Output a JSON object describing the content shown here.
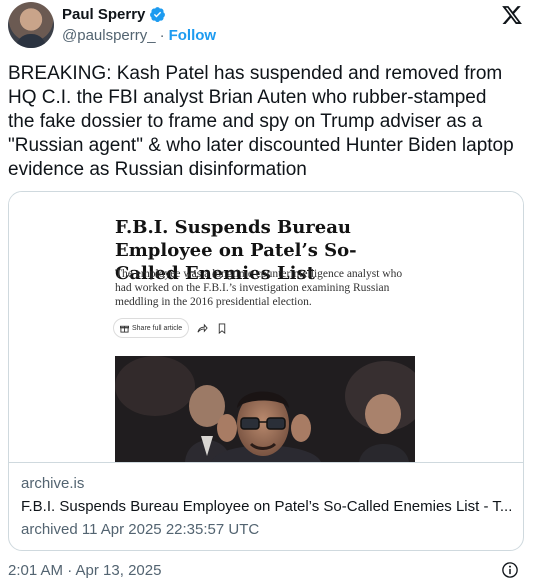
{
  "author": {
    "name": "Paul Sperry",
    "handle": "@paulsperry_",
    "separator": "·",
    "follow_label": "Follow"
  },
  "tweet": {
    "text": "BREAKING: Kash Patel has suspended and removed from HQ C.I. the FBI analyst Brian Auten who rubber-stamped the fake dossier to frame and spy on Trump adviser as a \"Russian agent\" & who later discounted Hunter Biden laptop evidence as Russian disinformation"
  },
  "card": {
    "article_title": "F.B.I. Suspends Bureau Employee on Patel’s So-Called Enemies List",
    "article_summary": "The employee was a longtime counterintelligence analyst who had worked on the F.B.I.’s investigation examining Russian meddling in the 2016 presidential election.",
    "share_label": "Share full article",
    "domain": "archive.is",
    "title": "F.B.I. Suspends Bureau Employee on Patel’s So-Called Enemies List - T...",
    "archived": "archived 11 Apr 2025 22:35:57 UTC"
  },
  "footer": {
    "timestamp": "2:01 AM · Apr 13, 2025"
  },
  "colors": {
    "accent": "#1d9bf0",
    "secondary_text": "#536471",
    "border": "#cfd9de"
  },
  "icons": [
    "verified-badge-icon",
    "x-logo-icon",
    "gift-icon",
    "share-icon",
    "bookmark-icon",
    "info-icon"
  ]
}
